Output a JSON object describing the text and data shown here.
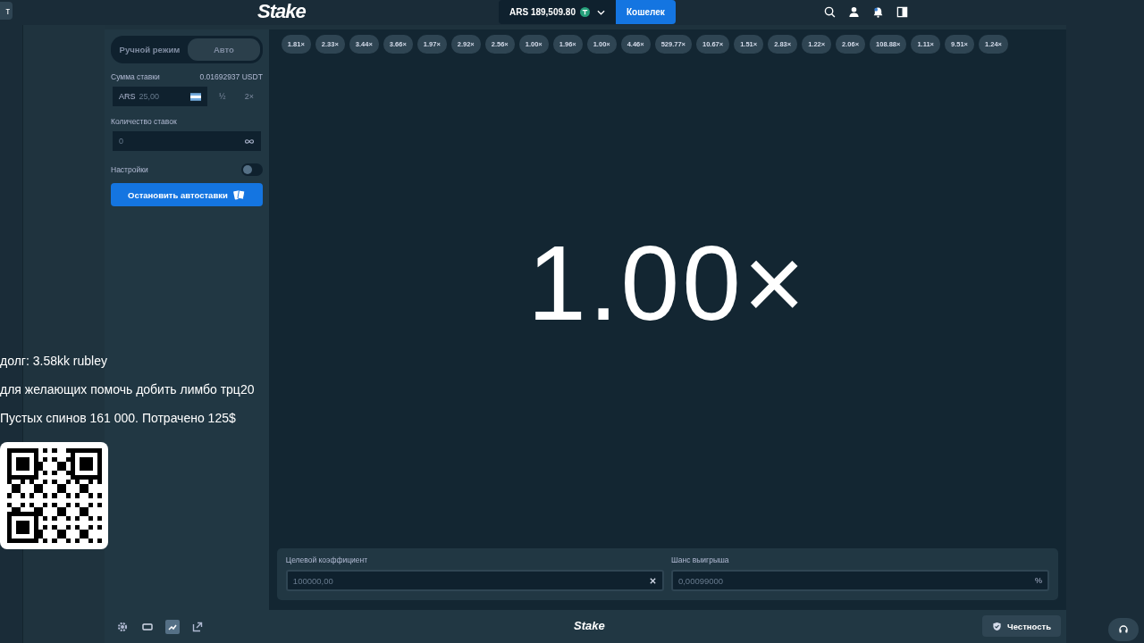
{
  "corner_button": "т",
  "topbar": {
    "logo": "Stake",
    "balance": "ARS 189,509.80",
    "wallet_button": "Кошелек"
  },
  "mode_tabs": [
    {
      "label": "Ручной режим",
      "selected": false
    },
    {
      "label": "Авто",
      "selected": true
    }
  ],
  "bet": {
    "label": "Сумма ставки",
    "converted": "0.01692937 USDT",
    "currency": "ARS",
    "value": "25,00",
    "half": "½",
    "double": "2×"
  },
  "bet_count": {
    "label": "Количество ставок",
    "value": "0"
  },
  "settings": {
    "label": "Настройки",
    "on": false
  },
  "stop_button": "Остановить автоставки",
  "history": [
    "1.81×",
    "2.33×",
    "3.44×",
    "3.66×",
    "1.97×",
    "2.92×",
    "2.56×",
    "1.00×",
    "1.96×",
    "1.00×",
    "4.46×",
    "529.77×",
    "10.67×",
    "1.51×",
    "2.83×",
    "1.22×",
    "2.06×",
    "108.88×",
    "1.11×",
    "9.51×",
    "1.24×"
  ],
  "result": "1.00×",
  "target": {
    "label": "Целевой коэффициент",
    "value": "100000,00"
  },
  "chance": {
    "label": "Шанс выигрыша",
    "value": "0,00099000",
    "suffix": "%"
  },
  "footer": {
    "tools": [
      {
        "kind": "settings",
        "selected": false
      },
      {
        "kind": "theatre",
        "selected": false
      },
      {
        "kind": "stats",
        "selected": true
      },
      {
        "kind": "popout",
        "selected": false
      }
    ],
    "logo": "Stake",
    "fairness_button": "Честность"
  },
  "overlay": {
    "lines": [
      "долг: 3.58kk rubley",
      "для желающих помочь добить лимбо трц20",
      "Пустых спинов 161 000. Потрачено 125$"
    ]
  }
}
